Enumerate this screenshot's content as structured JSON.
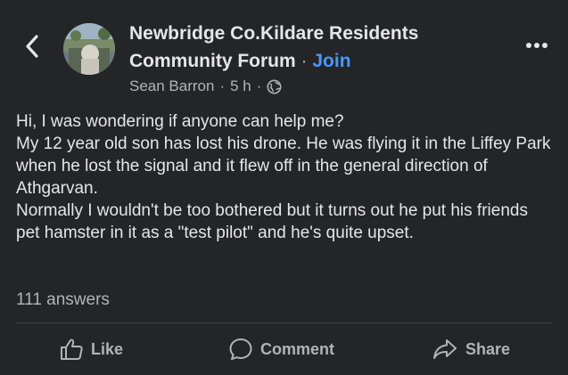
{
  "post_header": {
    "group_name_line1": "Newbridge Co.Kildare Residents",
    "group_name_line2": "Community Forum",
    "separator": "·",
    "join_label": "Join",
    "author": "Sean Barron",
    "time": "5 h",
    "privacy_icon": "globe-icon",
    "back_icon": "chevron-left-icon",
    "more_icon": "more-horizontal-icon"
  },
  "post": {
    "lines": [
      "Hi, I was wondering if anyone can help me?",
      "My 12 year old son has lost his drone. He was flying it in the Liffey Park when he lost the signal and it flew off in the general direction of Athgarvan.",
      "Normally I wouldn't be too bothered but it turns out he put his friends pet hamster in it as a \"test pilot\" and he's quite upset."
    ],
    "answers_label": "111 answers"
  },
  "actions": {
    "like_label": "Like",
    "comment_label": "Comment",
    "share_label": "Share"
  },
  "colors": {
    "background": "#242526",
    "text_primary": "#e4e6eb",
    "text_secondary": "#b0b3b8",
    "join_accent": "#4599ff",
    "divider": "#3e4042"
  }
}
